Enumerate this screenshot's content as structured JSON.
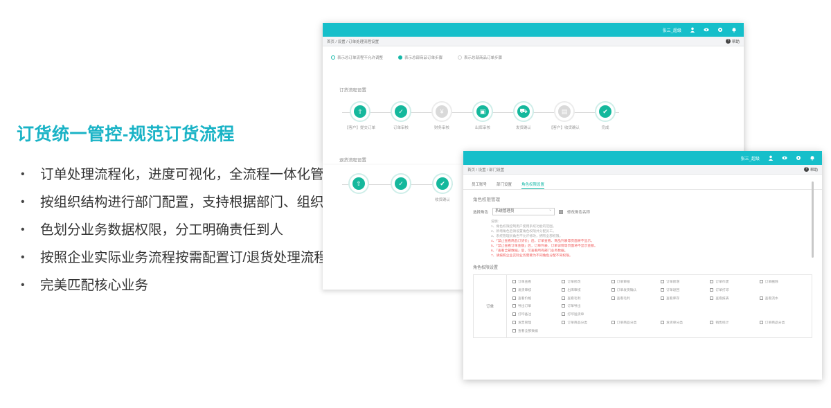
{
  "slide": {
    "headline": "订货统一管控-规范订货流程",
    "bullets": [
      "订单处理流程化，进度可视化，全流程一体化管控",
      "按组织结构进行部门配置，支持根据部门、组织角",
      "色划分业务数据权限，分工明确责任到人",
      "按照企业实际业务流程按需配置订/退货处理流程，",
      "完美匹配核心业务"
    ]
  },
  "colors": {
    "accent": "#1ab3c6",
    "topbar": "#16bfca",
    "step_active": "#14b89c",
    "note_red": "#f05a5a"
  },
  "panel1": {
    "header_user": "张三_超级",
    "icons": [
      "user-icon",
      "eye-icon",
      "gear-icon",
      "bell-icon"
    ],
    "breadcrumb": "首页 / 设置 / 订单处理流程设置",
    "help": "帮助",
    "radios": [
      "表示总订单流程不允许调整",
      "表示总部商品订单步骤",
      "表示总部商品订单步骤"
    ],
    "section_order": "订货流程设置",
    "order_steps": [
      {
        "label": "【客户】提交订单",
        "active": true
      },
      {
        "label": "订单审核",
        "active": true
      },
      {
        "label": "财务审核",
        "active": false
      },
      {
        "label": "出库审核",
        "active": true
      },
      {
        "label": "发货确认",
        "active": true
      },
      {
        "label": "【客户】收货确认",
        "active": false
      },
      {
        "label": "完成",
        "active": true
      }
    ],
    "section_return": "退货流程设置",
    "return_steps": [
      {
        "label": "",
        "active": true
      },
      {
        "label": "",
        "active": true
      },
      {
        "label": "收货确认",
        "active": true
      }
    ]
  },
  "panel2": {
    "header_user": "张三_超级",
    "breadcrumb": "首页 / 设置 / 部门设置",
    "help": "帮助",
    "tabs": [
      "员工账号",
      "部门设置",
      "角色权限设置"
    ],
    "active_tab": 2,
    "section_role": "角色权限管理",
    "role_label": "选择角色",
    "role_value": "系统管理员",
    "role_checkbox": "修改角色名称",
    "notes_title": "说明:",
    "notes": [
      "1、角色权限控制用户使用系统功能的范围。",
      "2、新增角色后请设置角色权限并分配员工。",
      "3、系统管理员角色不允许修改，拥有全部权限。",
      "4、「禁止查看商品订货价」后，订单查看、商品列表等页面将不显示。",
      "5、「禁止查看订单金额」后，订单列表、订单详情等页面将不显示金额。",
      "6、「查看全部数据」后，可查看所有部门业务数据。",
      "7、请按照企业实际业务需要为不同角色分配不同权限。"
    ],
    "notes_red_from": 3,
    "perm_title": "角色权限设置",
    "perm_group": "订单",
    "perms": [
      "订单查看",
      "订单修改",
      "订单审核",
      "订单新增",
      "订单作废",
      "订单删除",
      "发货审核",
      "出库审核",
      "订单发货确认",
      "订单退回",
      "订单打印",
      "",
      "查看价格",
      "查看毛利",
      "查看毛利",
      "查看库存",
      "查看报表",
      "查看流水",
      "导出订单",
      "订单导出",
      "",
      "",
      "",
      "",
      "打印备注",
      "打印送货单",
      "",
      "",
      "",
      "",
      "发票管理",
      "订单商品分类",
      "订单商品分类",
      "发货单分类",
      "销售统计",
      "订单商品分类",
      "查看全部数据",
      "",
      "",
      "",
      "",
      ""
    ]
  }
}
